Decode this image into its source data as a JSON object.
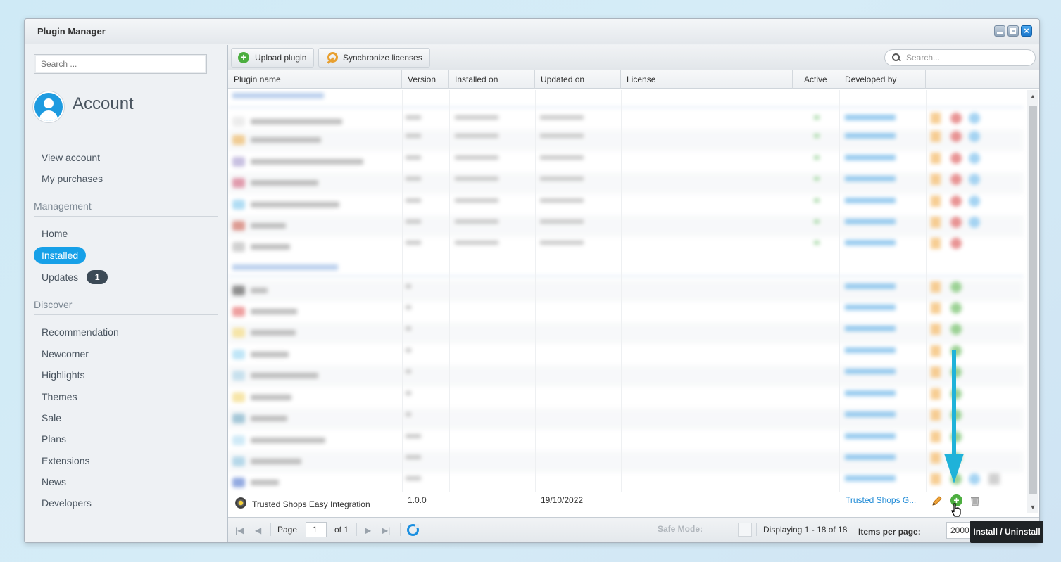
{
  "window": {
    "title": "Plugin Manager"
  },
  "sidebar": {
    "search_placeholder": "Search ...",
    "account_label": "Account",
    "account_items": [
      {
        "label": "View account"
      },
      {
        "label": "My purchases"
      }
    ],
    "management_title": "Management",
    "management_items": [
      {
        "label": "Home"
      },
      {
        "label": "Installed",
        "active": true
      },
      {
        "label": "Updates",
        "badge": "1"
      }
    ],
    "discover_title": "Discover",
    "discover_items": [
      {
        "label": "Recommendation"
      },
      {
        "label": "Newcomer"
      },
      {
        "label": "Highlights"
      },
      {
        "label": "Themes"
      },
      {
        "label": "Sale"
      },
      {
        "label": "Plans"
      },
      {
        "label": "Extensions"
      },
      {
        "label": "News"
      },
      {
        "label": "Developers"
      }
    ]
  },
  "toolbar": {
    "upload_label": "Upload plugin",
    "sync_label": "Synchronize licenses",
    "search_placeholder": "Search..."
  },
  "columns": [
    "Plugin name",
    "Version",
    "Installed on",
    "Updated on",
    "License",
    "Active",
    "Developed by"
  ],
  "visible_row": {
    "name": "Trusted Shops Easy Integration",
    "version": "1.0.0",
    "installed_on": "",
    "updated_on": "19/10/2022",
    "license": "",
    "developer": "Trusted Shops G..."
  },
  "pager": {
    "page_label": "Page",
    "page_value": "1",
    "of_label": "of 1",
    "safe_mode_label": "Safe Mode:",
    "displaying": "Displaying 1 - 18 of 18",
    "items_per_page_label": "Items per page:",
    "items_per_page_value": "2000"
  },
  "tooltip": "Install / Uninstall",
  "colors": {
    "accent": "#16a0e8",
    "annotation_arrow": "#1fb2d9",
    "install_green": "#4cae3f"
  }
}
